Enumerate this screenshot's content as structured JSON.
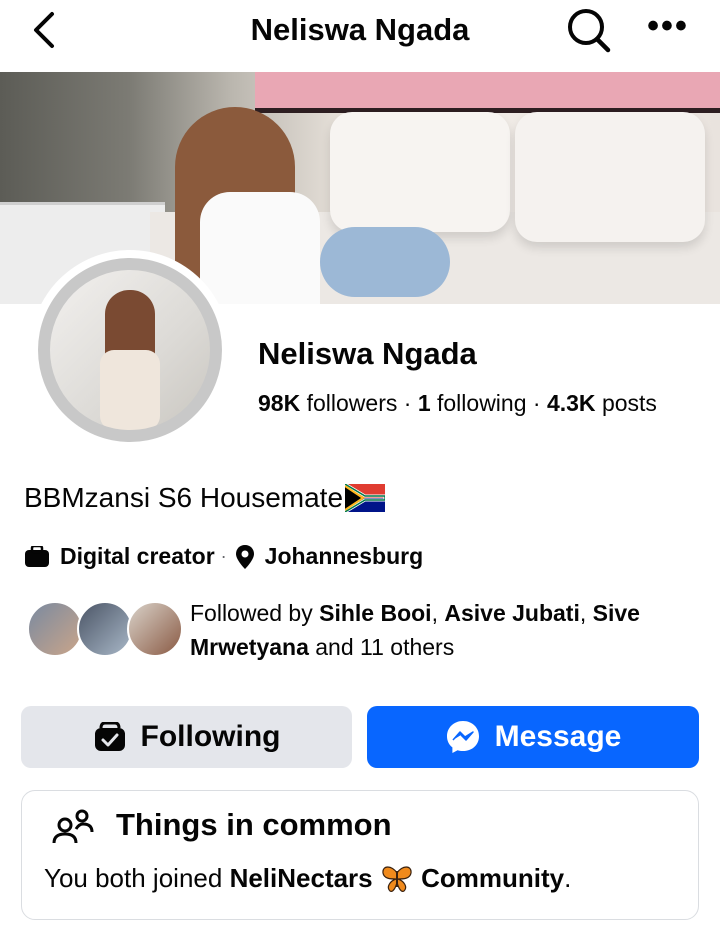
{
  "header": {
    "title": "Neliswa Ngada",
    "back_icon": "chevron-left-icon",
    "search_icon": "search-icon",
    "more_label": "•••"
  },
  "profile": {
    "name": "Neliswa Ngada",
    "followers_count": "98K",
    "followers_label": "followers",
    "following_count": "1",
    "following_label": "following",
    "posts_count": "4.3K",
    "posts_label": "posts",
    "sep": "·",
    "bio": "BBMzansi S6 Housemate",
    "category": "Digital creator",
    "location": "Johannesburg"
  },
  "followed_by": {
    "prefix": "Followed by",
    "name1": "Sihle Booi",
    "name2": "Asive Jubati",
    "name3": "Sive Mrwetyana",
    "suffix": "and 11 others",
    "comma": ","
  },
  "actions": {
    "following_label": "Following",
    "message_label": "Message"
  },
  "common": {
    "title": "Things in common",
    "text_prefix": "You both joined",
    "group_name": "NeliNectars",
    "text_suffix": "Community",
    "period": "."
  },
  "colors": {
    "accent": "#0866ff",
    "secondary_button": "#e4e6eb",
    "text": "#050505"
  }
}
